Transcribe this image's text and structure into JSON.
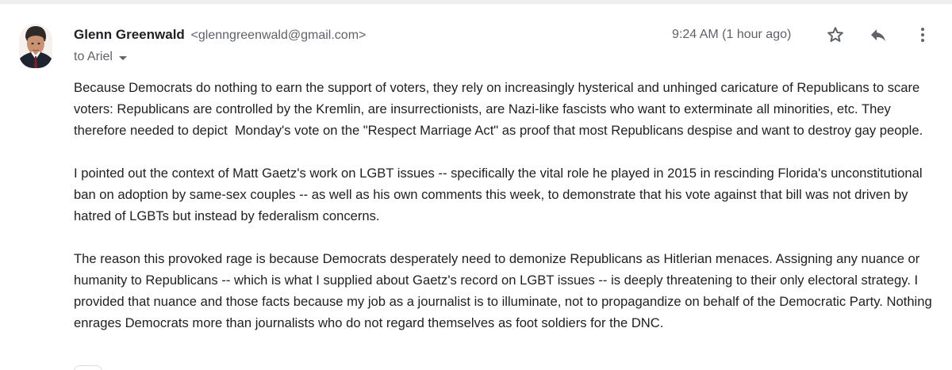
{
  "email": {
    "sender_name": "Glenn Greenwald",
    "sender_email": "<glenngreenwald@gmail.com>",
    "recipient": "to Ariel",
    "timestamp": "9:24 AM (1 hour ago)",
    "paragraphs": [
      "Because Democrats do nothing to earn the support of voters, they rely on increasingly hysterical and unhinged caricature of Republicans to scare voters: Republicans are controlled by the Kremlin, are insurrectionists, are Nazi-like fascists who want to exterminate all minorities, etc. They therefore needed to depict  Monday's vote on the \"Respect Marriage Act\" as proof that most Republicans despise and want to destroy gay people.",
      "I pointed out the context of Matt Gaetz's work on LGBT issues -- specifically the vital role he played in 2015 in rescinding Florida's unconstitutional ban on adoption by same-sex couples -- as well as his own comments this week, to demonstrate that his vote against that bill was not driven by hatred of LGBTs but instead by federalism concerns.",
      "The reason this provoked rage is because Democrats desperately need to demonize Republicans as Hitlerian menaces. Assigning any nuance or humanity to Republicans -- which is what I supplied about Gaetz's record on LGBT issues -- is deeply threatening to their only electoral strategy. I provided that nuance and those facts because my job as a journalist is to illuminate, not to propagandize on behalf of the Democratic Party. Nothing enrages Democrats more than journalists who do not regard themselves as foot soldiers for the DNC."
    ]
  },
  "icons": {
    "avatar": "avatar",
    "star": "star-icon",
    "reply": "reply-icon",
    "more": "more-vert-icon",
    "recipient_caret": "chevron-down-icon"
  },
  "colors": {
    "text_primary": "#202124",
    "text_secondary": "#5f6368",
    "icon": "#5f6368"
  }
}
